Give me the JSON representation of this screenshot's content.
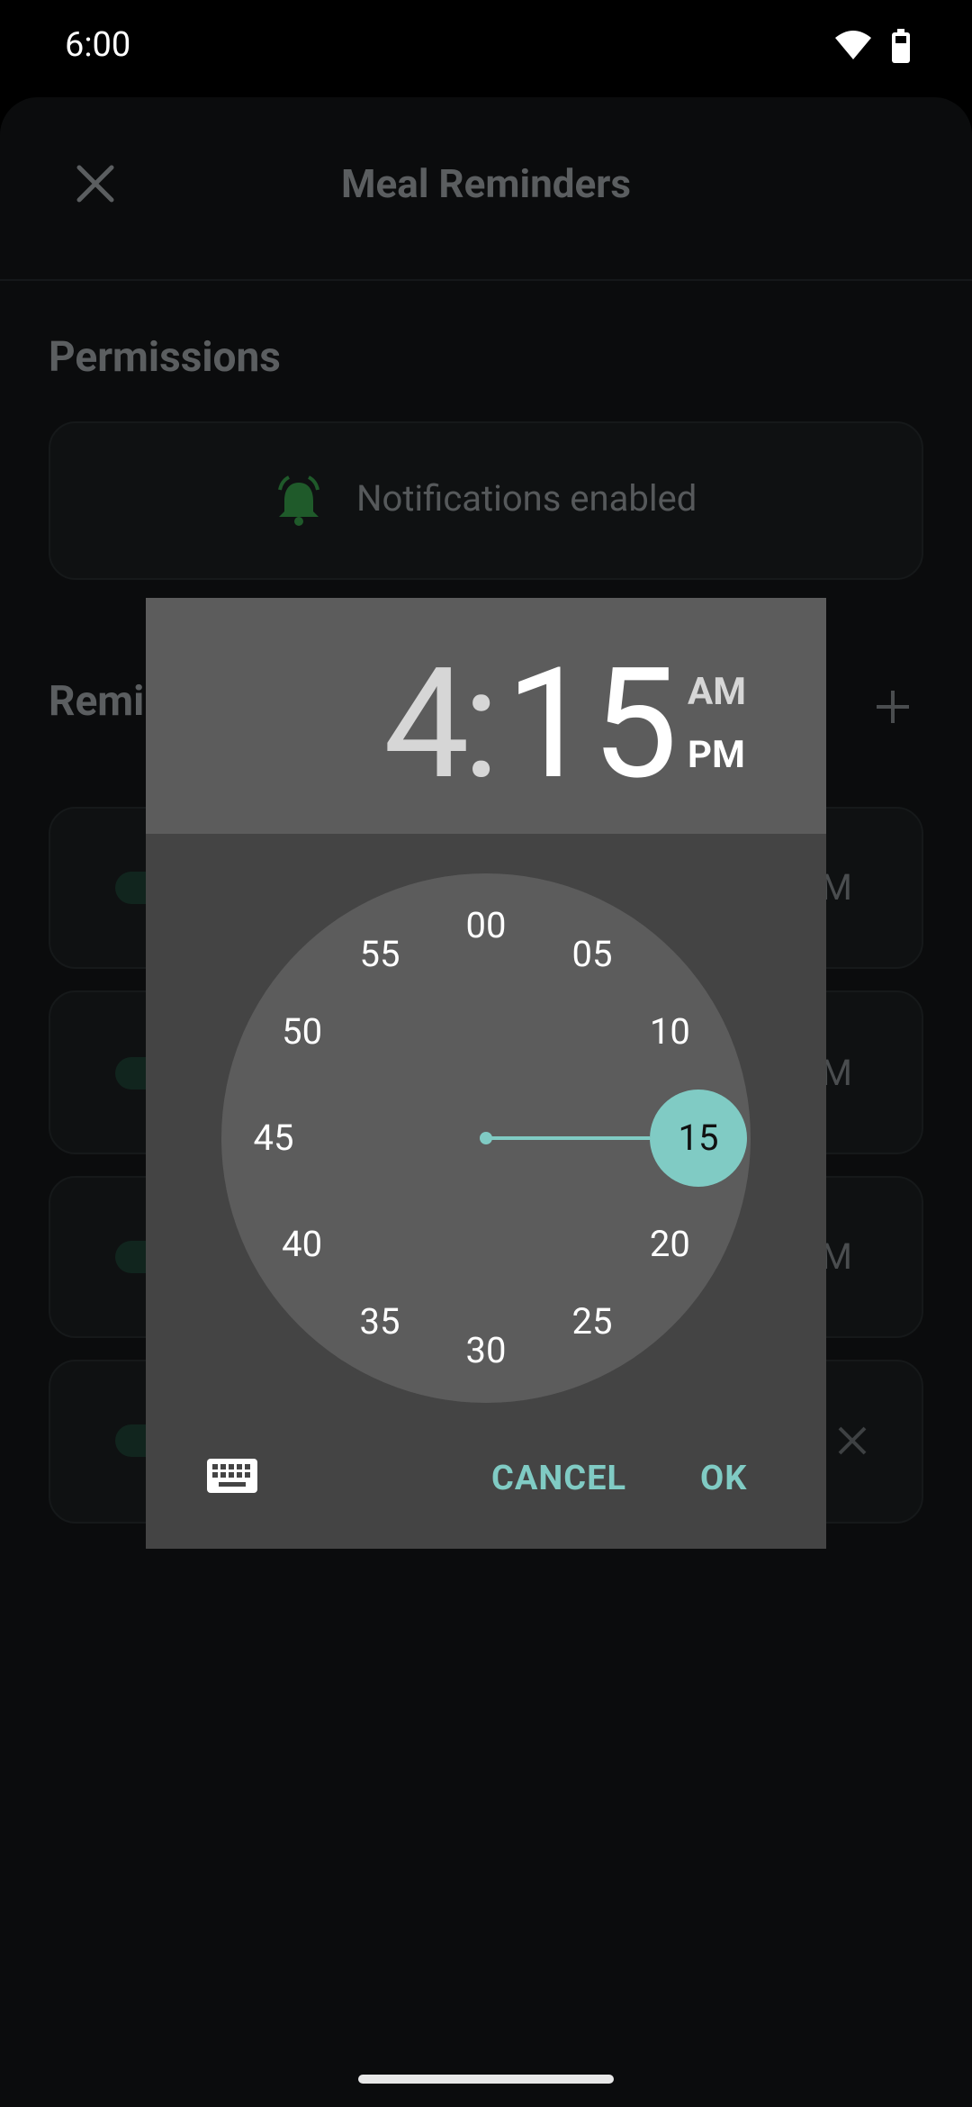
{
  "status_bar": {
    "time": "6:00"
  },
  "app": {
    "title": "Meal Reminders",
    "permissions_section": "Permissions",
    "notifications_status": "Notifications enabled",
    "reminders_section_partial": "Remi",
    "row_ampm_stub": "M"
  },
  "dialog": {
    "hour": "4",
    "colon": ":",
    "minute": "15",
    "am_label": "AM",
    "pm_label": "PM",
    "selected_period": "PM",
    "dial_labels": [
      "00",
      "05",
      "10",
      "15",
      "20",
      "25",
      "30",
      "35",
      "40",
      "45",
      "50",
      "55"
    ],
    "selected_minute": "15",
    "cancel_label": "CANCEL",
    "ok_label": "OK"
  },
  "colors": {
    "accent": "#80cbc4",
    "dialog_bg": "#444444",
    "dialog_header": "#5c5c5c",
    "dial_bg": "#5c5c5c"
  }
}
